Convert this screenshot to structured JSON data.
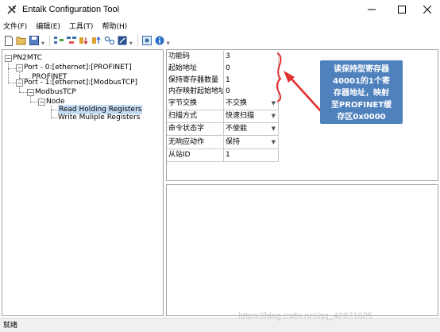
{
  "window": {
    "title": "Entalk Configuration Tool"
  },
  "menu": {
    "items": [
      "文件(F)",
      "编辑(E)",
      "工具(T)",
      "帮助(H)"
    ]
  },
  "toolbar": {
    "icons": [
      "new-file-icon",
      "open-folder-icon",
      "save-icon",
      "tree-add-icon",
      "tree-remove-icon",
      "download-icon",
      "upload-icon",
      "link-icon",
      "edit-icon",
      "config-icon",
      "info-icon"
    ]
  },
  "tree": {
    "root": "PN2MTC",
    "port0": "Port - 0:[ethernet]:[PROFINET]",
    "profinet": "PROFINET",
    "port1": "Port - 1:[ethernet]:[ModbusTCP]",
    "modbus": "ModbusTCP",
    "node": "Node",
    "read_holding": "Read Holding Registers",
    "write_multiple": "Write Muliple Registers"
  },
  "grid": {
    "rows": [
      {
        "label": "功能码",
        "value": "3"
      },
      {
        "label": "起始地址",
        "value": "0"
      },
      {
        "label": "保持寄存器数量",
        "value": "1"
      },
      {
        "label": "内存映射起始地址",
        "value": "0"
      },
      {
        "label": "字节交换",
        "value": "不交换"
      },
      {
        "label": "扫描方式",
        "value": "快速扫描"
      },
      {
        "label": "命令状态字",
        "value": "不使能"
      },
      {
        "label": "无响应动作",
        "value": "保持"
      },
      {
        "label": "从站ID",
        "value": "1"
      }
    ]
  },
  "callout": {
    "lines": [
      "读保持型寄存器",
      "40001的1个寄",
      "存器地址，映射",
      "至PROFINET缓",
      "存区0x0000"
    ],
    "color": "#4f81bd",
    "arrow_color": "#e03030"
  },
  "status": {
    "text": "就绪"
  },
  "watermark": "https://blog.csdn.net/qq_42871025"
}
